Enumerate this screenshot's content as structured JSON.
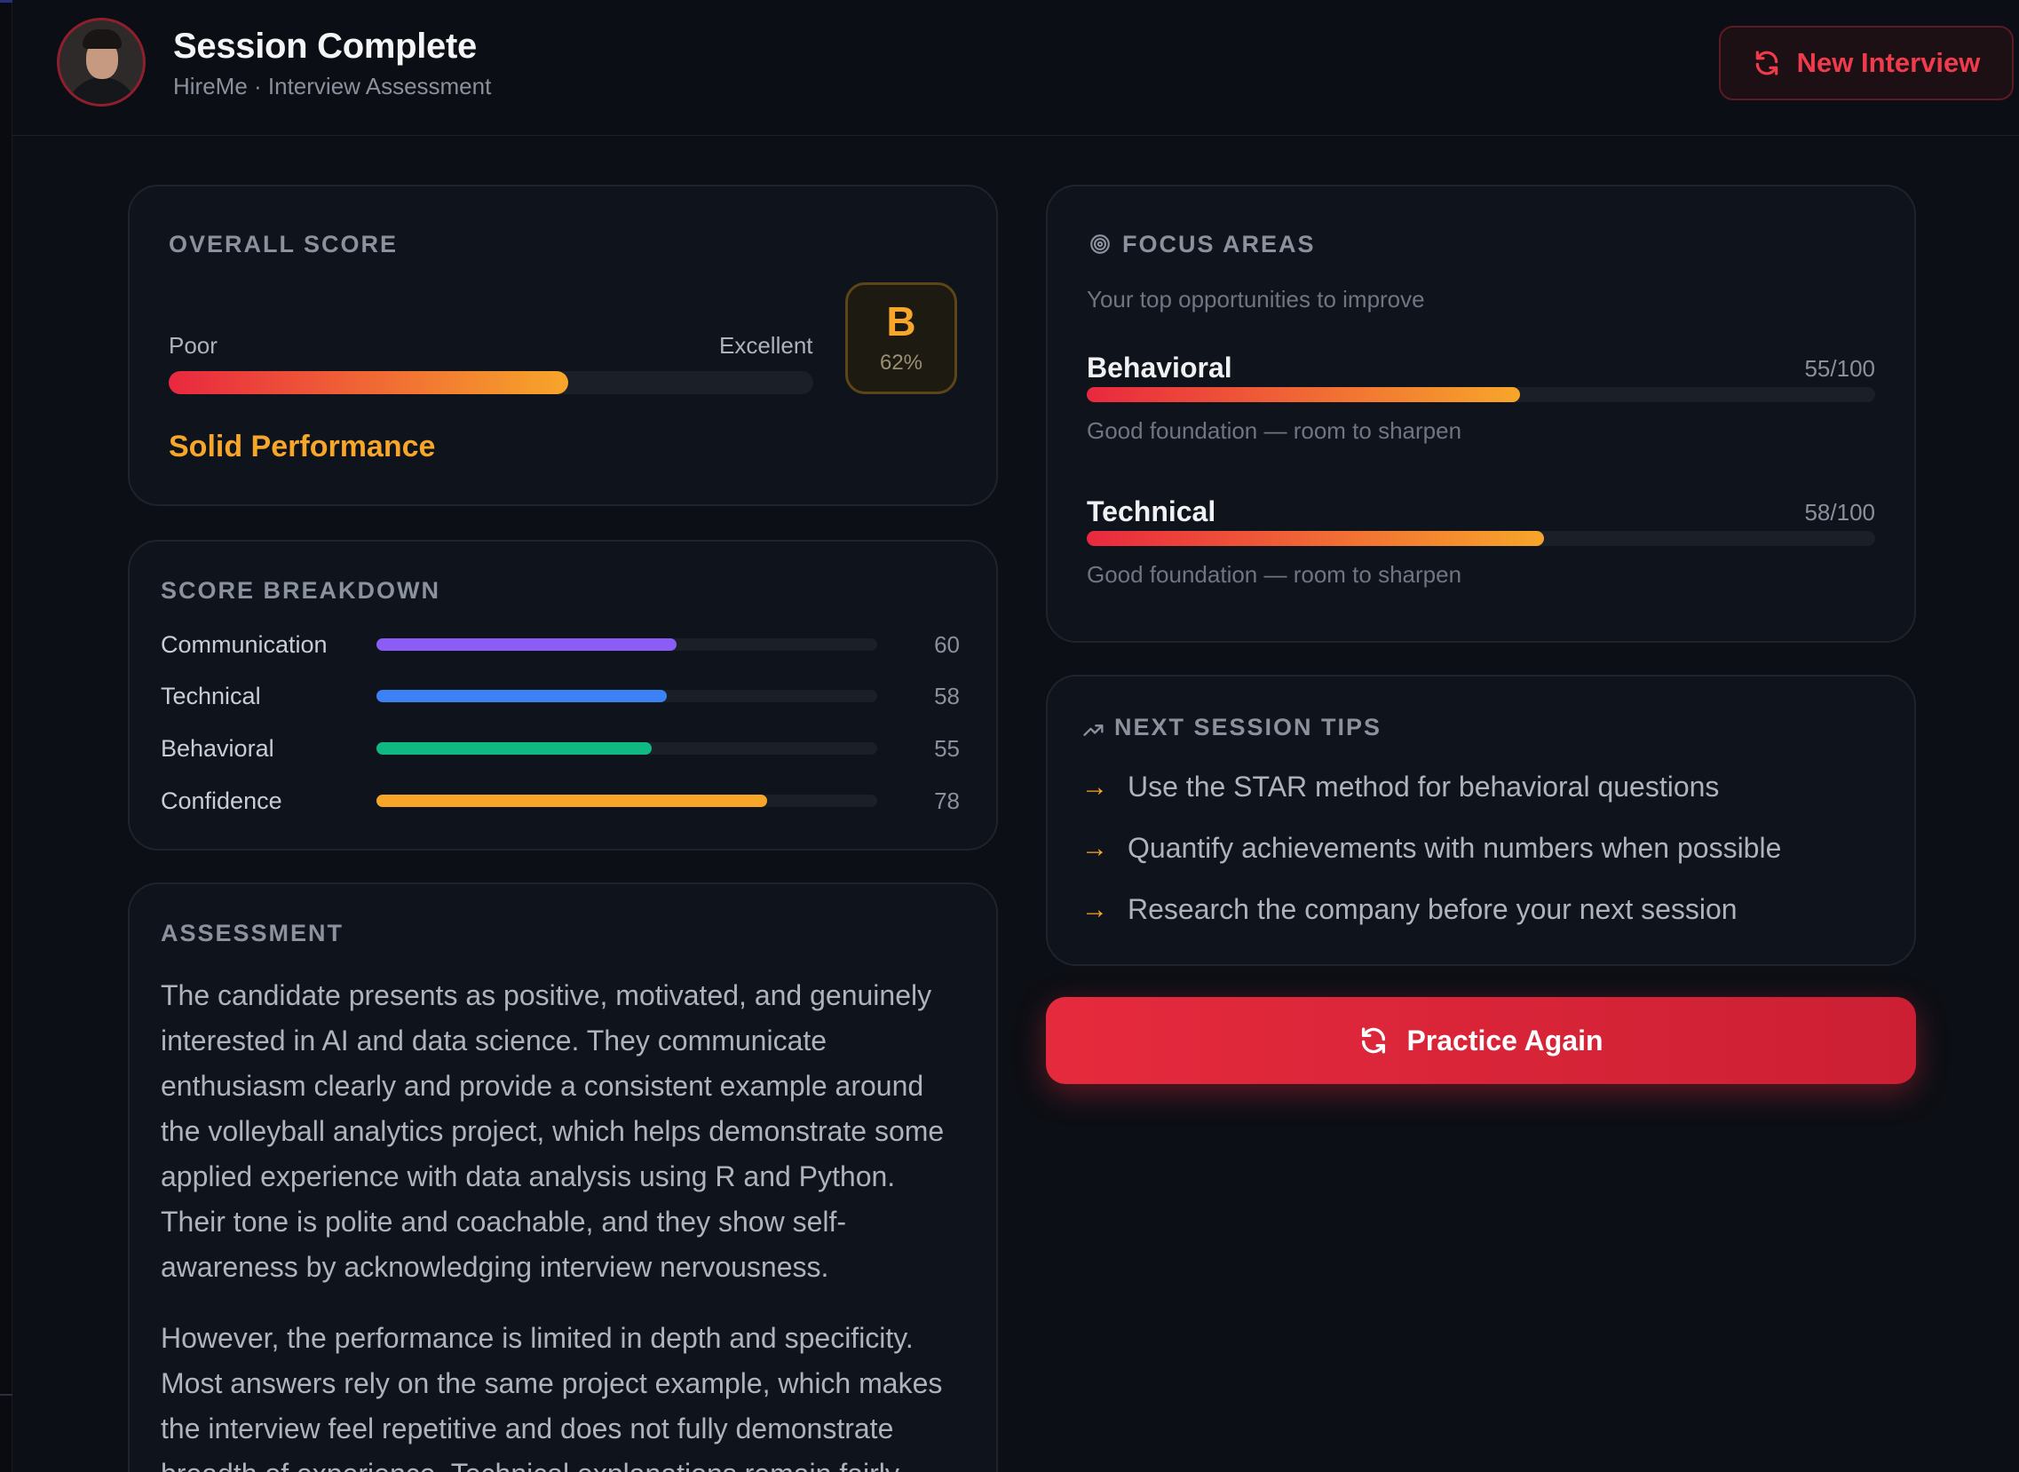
{
  "header": {
    "title": "Session Complete",
    "subtitle": "HireMe · Interview Assessment",
    "new_interview_label": "New Interview"
  },
  "overall": {
    "label": "OVERALL SCORE",
    "poor_label": "Poor",
    "excellent_label": "Excellent",
    "score_percent": 62,
    "grade": "B",
    "grade_percent": "62%",
    "verdict": "Solid Performance"
  },
  "breakdown": {
    "label": "SCORE BREAKDOWN",
    "items": [
      {
        "name": "Communication",
        "value": 60,
        "display": "60",
        "color": "#8b5cf6"
      },
      {
        "name": "Technical",
        "value": 58,
        "display": "58",
        "color": "#3b82f6"
      },
      {
        "name": "Behavioral",
        "value": 55,
        "display": "55",
        "color": "#10b981"
      },
      {
        "name": "Confidence",
        "value": 78,
        "display": "78",
        "color": "#f7a62a"
      }
    ]
  },
  "assessment": {
    "label": "ASSESSMENT",
    "paragraphs": [
      "The candidate presents as positive, motivated, and genuinely interested in AI and data science. They communicate enthusiasm clearly and provide a consistent example around the volleyball analytics project, which helps demonstrate some applied experience with data analysis using R and Python. Their tone is polite and coachable, and they show self-awareness by acknowledging interview nervousness.",
      "However, the performance is limited in depth and specificity. Most answers rely on the same project example, which makes the interview feel repetitive and does not fully demonstrate breadth of experience. Technical explanations remain fairly high"
    ]
  },
  "focus": {
    "label": "FOCUS AREAS",
    "subtitle": "Your top opportunities to improve",
    "items": [
      {
        "name": "Behavioral",
        "score": "55/100",
        "value": 55,
        "note": "Good foundation — room to sharpen"
      },
      {
        "name": "Technical",
        "score": "58/100",
        "value": 58,
        "note": "Good foundation — room to sharpen"
      }
    ]
  },
  "tips": {
    "label": "NEXT SESSION TIPS",
    "items": [
      "Use the STAR method for behavioral questions",
      "Quantify achievements with numbers when possible",
      "Research the company before your next session"
    ]
  },
  "practice_label": "Practice Again",
  "colors": {
    "accent_red": "#e9283f",
    "accent_orange": "#f7a62a",
    "background": "#0c0f15"
  }
}
